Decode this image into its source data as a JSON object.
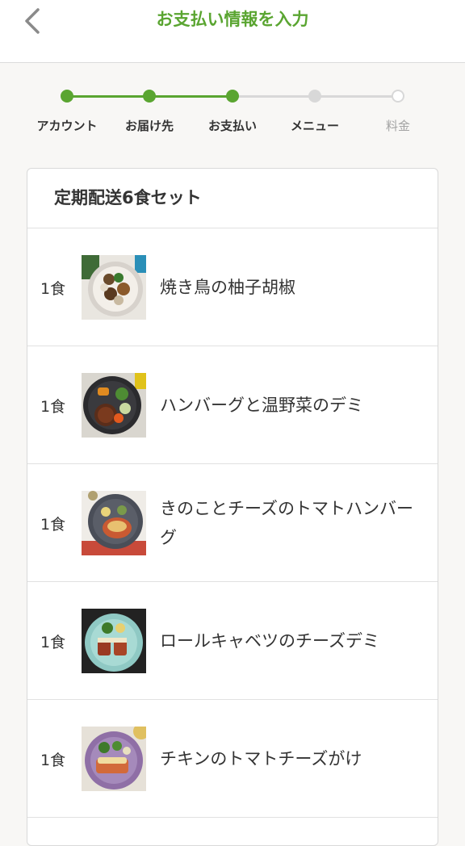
{
  "header": {
    "title": "お支払い情報を入力",
    "back_icon": "chevron-left-icon"
  },
  "colors": {
    "accent": "#5aa531",
    "inactive": "#d8d8d8"
  },
  "stepper": {
    "steps": [
      {
        "label": "アカウント",
        "state": "done"
      },
      {
        "label": "お届け先",
        "state": "done"
      },
      {
        "label": "お支払い",
        "state": "done"
      },
      {
        "label": "メニュー",
        "state": "upcoming"
      },
      {
        "label": "料金",
        "state": "upcoming"
      }
    ]
  },
  "plan": {
    "title": "定期配送6食セット",
    "items": [
      {
        "qty": "1食",
        "name": "焼き鳥の柚子胡椒"
      },
      {
        "qty": "1食",
        "name": "ハンバーグと温野菜のデミ"
      },
      {
        "qty": "1食",
        "name": "きのことチーズのトマトハンバーグ"
      },
      {
        "qty": "1食",
        "name": "ロールキャベツのチーズデミ"
      },
      {
        "qty": "1食",
        "name": "チキンのトマトチーズがけ"
      }
    ]
  }
}
